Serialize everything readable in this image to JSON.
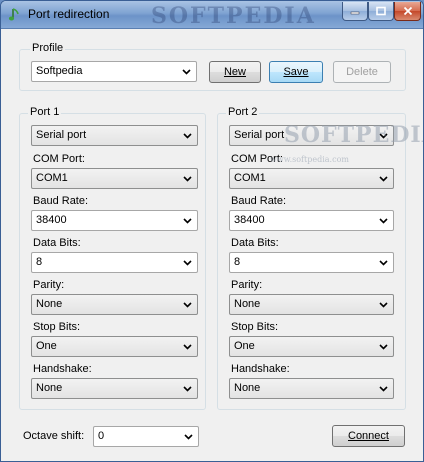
{
  "window": {
    "title": "Port redirection",
    "watermark_title": "SOFTPEDIA"
  },
  "profile": {
    "group_label": "Profile",
    "selected": "Softpedia",
    "new_label": "New",
    "save_label": "Save",
    "delete_label": "Delete"
  },
  "port1": {
    "group_label": "Port 1",
    "type": "Serial port",
    "com_port_label": "COM Port:",
    "com_port": "COM1",
    "baud_rate_label": "Baud Rate:",
    "baud_rate": "38400",
    "data_bits_label": "Data Bits:",
    "data_bits": "8",
    "parity_label": "Parity:",
    "parity": "None",
    "stop_bits_label": "Stop Bits:",
    "stop_bits": "One",
    "handshake_label": "Handshake:",
    "handshake": "None"
  },
  "port2": {
    "group_label": "Port 2",
    "type": "Serial port",
    "com_port_label": "COM Port:",
    "com_port": "COM1",
    "baud_rate_label": "Baud Rate:",
    "baud_rate": "38400",
    "data_bits_label": "Data Bits:",
    "data_bits": "8",
    "parity_label": "Parity:",
    "parity": "None",
    "stop_bits_label": "Stop Bits:",
    "stop_bits": "One",
    "handshake_label": "Handshake:",
    "handshake": "None"
  },
  "octave": {
    "label": "Octave shift:",
    "value": "0"
  },
  "connect_label": "Connect",
  "watermark": {
    "brand": "SOFTPEDIA",
    "url": "www.softpedia.com"
  },
  "colors": {
    "titlebar": "#7fa3d2",
    "close_button": "#c4482a",
    "default_button": "#bee6fd"
  },
  "icons": [
    "music-note-icon",
    "minimize-icon",
    "maximize-icon",
    "close-icon",
    "chevron-down-icon"
  ]
}
